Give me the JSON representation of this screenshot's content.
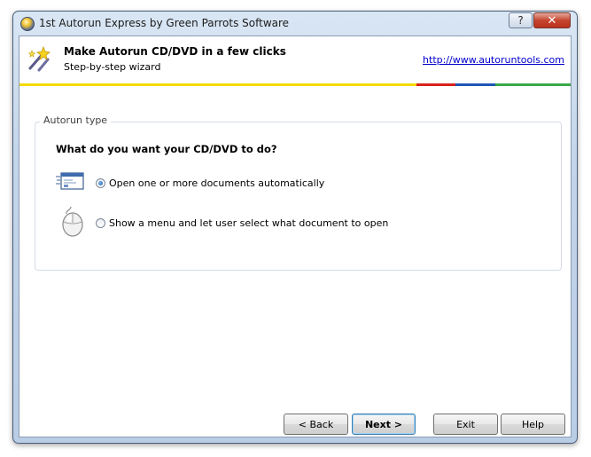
{
  "window": {
    "title": "1st Autorun Express by Green Parrots Software",
    "help_label": "?",
    "close_label": "✕"
  },
  "header": {
    "title": "Make Autorun CD/DVD in a few clicks",
    "subtitle": "Step-by-step wizard",
    "link": "http://www.autoruntools.com",
    "stripe_colors": [
      "#f3d90b",
      "#d9221c",
      "#1f55b5",
      "#3aa84a"
    ]
  },
  "autorun": {
    "group_label": "Autorun type",
    "question": "What do you want your CD/DVD to do?",
    "options": [
      {
        "label": "Open one or more documents automatically",
        "icon": "document-window-icon",
        "checked": true
      },
      {
        "label": "Show a menu and let user select what document to open",
        "icon": "mouse-icon",
        "checked": false
      }
    ]
  },
  "buttons": {
    "back": "< Back",
    "next": "Next >",
    "exit": "Exit",
    "help": "Help"
  }
}
